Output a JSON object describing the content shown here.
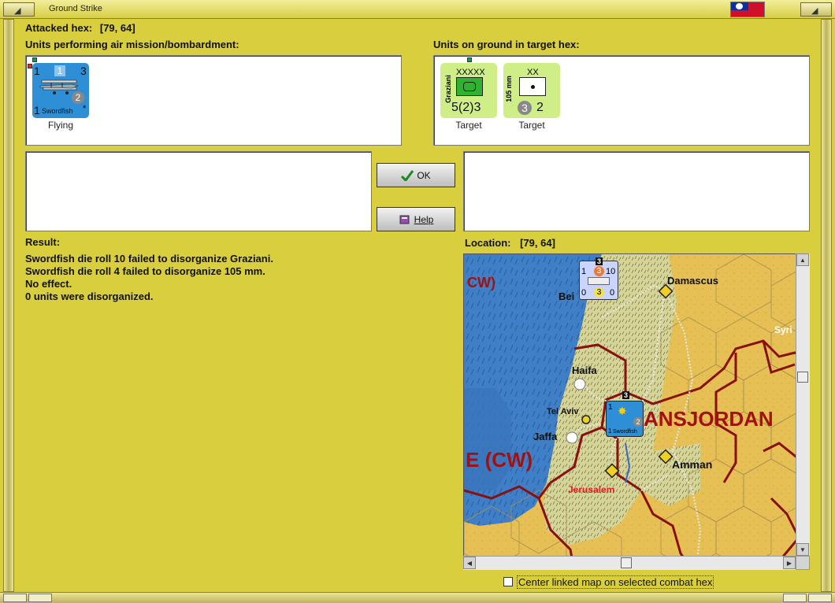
{
  "window": {
    "title": "Ground Strike"
  },
  "header": {
    "attacked_hex_label": "Attacked hex:",
    "attacked_hex_value": "[79, 64]",
    "air_units_label": "Units performing air mission/bombardment:",
    "ground_units_label": "Units on ground in target hex:"
  },
  "air_units": [
    {
      "name": "Swordfish",
      "icon": "biplane-icon",
      "top_left": "1",
      "top_mid": "1",
      "top_right": "3",
      "mid_right": "2",
      "bottom_left": "1",
      "bottom_right": "*",
      "status": "Flying",
      "color": "#2e8fd6"
    }
  ],
  "ground_units": [
    {
      "name": "Graziani",
      "size": "XXXXX",
      "icon": "hq-icon",
      "values": "5(2)3",
      "status": "Target",
      "color": "#cfee88"
    },
    {
      "name": "105 mm",
      "size": "XX",
      "icon": "artillery-icon",
      "value_left": "3",
      "value_right": "2",
      "status": "Target",
      "color": "#cfee88"
    }
  ],
  "buttons": {
    "ok_label": "OK",
    "help_label": "Help"
  },
  "result": {
    "label": "Result:",
    "lines": [
      "Swordfish die roll 10 failed to disorganize Graziani.",
      "Swordfish die roll 4 failed to disorganize 105 mm.",
      "No effect.",
      "0 units were disorganized."
    ]
  },
  "location": {
    "label": "Location:",
    "value": "[79, 64]"
  },
  "map": {
    "labels": {
      "cw_top": "CW)",
      "damascus": "Damascus",
      "beirut": "Bei",
      "syria": "Syri",
      "haifa": "Haifa",
      "tel_aviv": "Tel Aviv",
      "jaffa": "Jaffa",
      "transjordan": "ANSJORDAN",
      "amman": "Amman",
      "jerusalem": "Jerusalem",
      "cw_bottom": "E (CW)"
    },
    "stack_top": {
      "count": "3",
      "tl": "1",
      "tm": "3",
      "tr": "10",
      "bl": "0",
      "bm": "3",
      "br": "0"
    },
    "stack_air": {
      "count": "3",
      "tl": "1",
      "br": "2",
      "bl": "1",
      "name": "Swordfish"
    },
    "colors": {
      "sea": "#3f7fc8",
      "desert": "#e6bf55",
      "hills": "#d7d49a",
      "border": "#8a1010"
    }
  },
  "footer": {
    "center_map_label": "Center linked map on selected combat hex"
  },
  "colors": {
    "dialog_bg": "#d9cf3e",
    "air_counter": "#2e8fd6",
    "ground_counter": "#cfee88"
  }
}
